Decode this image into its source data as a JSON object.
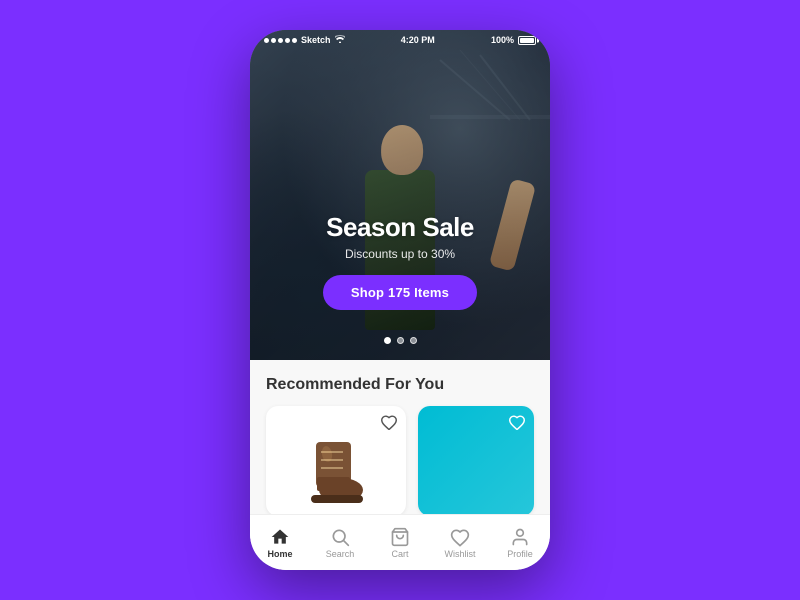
{
  "statusBar": {
    "carrier": "Sketch",
    "time": "4:20 PM",
    "battery": "100%"
  },
  "hero": {
    "title": "Season Sale",
    "subtitle": "Discounts up to 30%",
    "cta": "Shop 175 Items",
    "dots": [
      {
        "active": true
      },
      {
        "active": false
      },
      {
        "active": false
      }
    ]
  },
  "recommended": {
    "title": "Recommended For You",
    "products": [
      {
        "id": 1,
        "type": "boot",
        "wishlisted": false
      },
      {
        "id": 2,
        "type": "cyan",
        "wishlisted": false
      }
    ]
  },
  "tabBar": {
    "items": [
      {
        "id": "home",
        "label": "Home",
        "active": true
      },
      {
        "id": "search",
        "label": "Search",
        "active": false
      },
      {
        "id": "cart",
        "label": "Cart",
        "active": false
      },
      {
        "id": "wishlist",
        "label": "Wishlist",
        "active": false
      },
      {
        "id": "profile",
        "label": "Profile",
        "active": false
      }
    ]
  },
  "colors": {
    "accent": "#7B2FFF",
    "tabActive": "#333333",
    "tabInactive": "#999999"
  }
}
